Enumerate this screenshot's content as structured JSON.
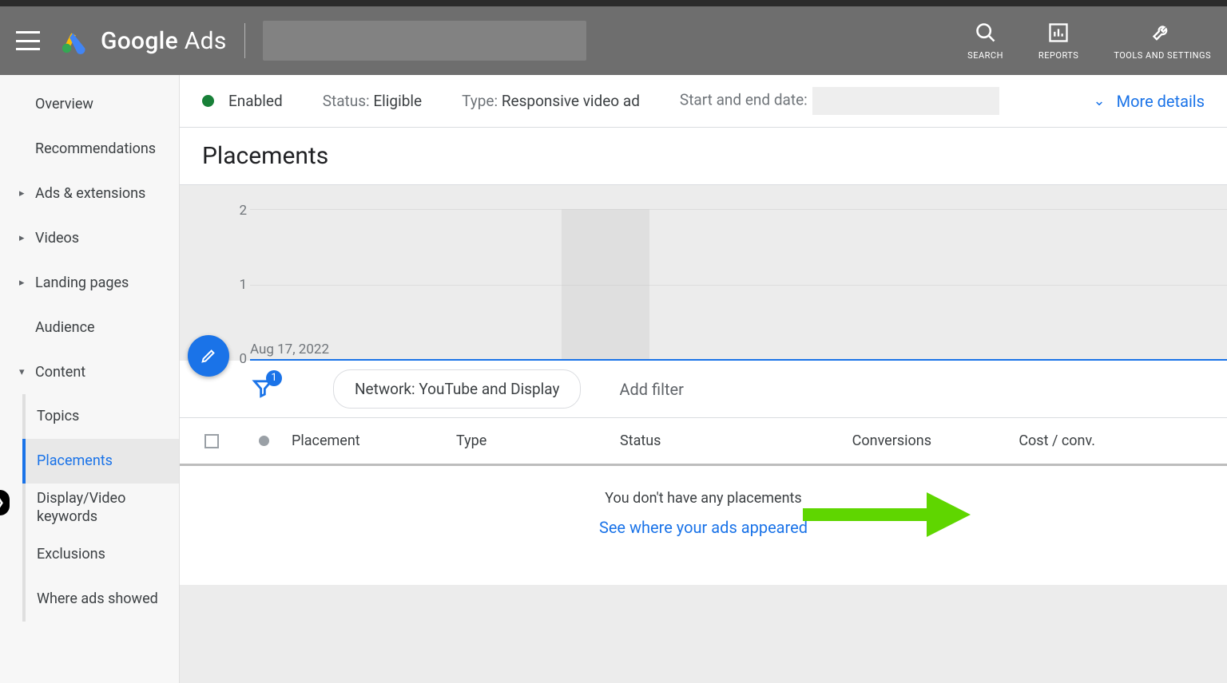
{
  "header": {
    "brand_google": "Google",
    "brand_ads": "Ads",
    "tools": {
      "search": "SEARCH",
      "reports": "REPORTS",
      "settings": "TOOLS AND SETTINGS"
    }
  },
  "sidebar": {
    "items": [
      {
        "label": "Overview",
        "kind": "plain"
      },
      {
        "label": "Recommendations",
        "kind": "plain"
      },
      {
        "label": "Ads & extensions",
        "kind": "expandable"
      },
      {
        "label": "Videos",
        "kind": "expandable"
      },
      {
        "label": "Landing pages",
        "kind": "expandable"
      },
      {
        "label": "Audience",
        "kind": "plain"
      },
      {
        "label": "Content",
        "kind": "expanded"
      }
    ],
    "content_children": [
      {
        "label": "Topics"
      },
      {
        "label": "Placements",
        "active": true
      },
      {
        "label": "Display/Video keywords"
      },
      {
        "label": "Exclusions"
      },
      {
        "label": "Where ads showed"
      }
    ]
  },
  "status": {
    "enabled": "Enabled",
    "status_k": "Status:",
    "status_v": "Eligible",
    "type_k": "Type:",
    "type_v": "Responsive video ad",
    "date_k": "Start and end date:",
    "more": "More details"
  },
  "page_title": "Placements",
  "chart_data": {
    "type": "line",
    "yticks": [
      "2",
      "1",
      "0"
    ],
    "xlabel": "Aug 17, 2022",
    "series": [
      {
        "name": "metric",
        "values": [
          0
        ]
      }
    ],
    "ylim": [
      0,
      2
    ]
  },
  "filters": {
    "badge": "1",
    "chip": "Network: YouTube and Display",
    "add": "Add filter"
  },
  "table": {
    "cols": {
      "placement": "Placement",
      "type": "Type",
      "status": "Status",
      "conv": "Conversions",
      "cost": "Cost / conv."
    }
  },
  "empty": {
    "msg": "You don't have any placements",
    "link": "See where your ads appeared"
  }
}
